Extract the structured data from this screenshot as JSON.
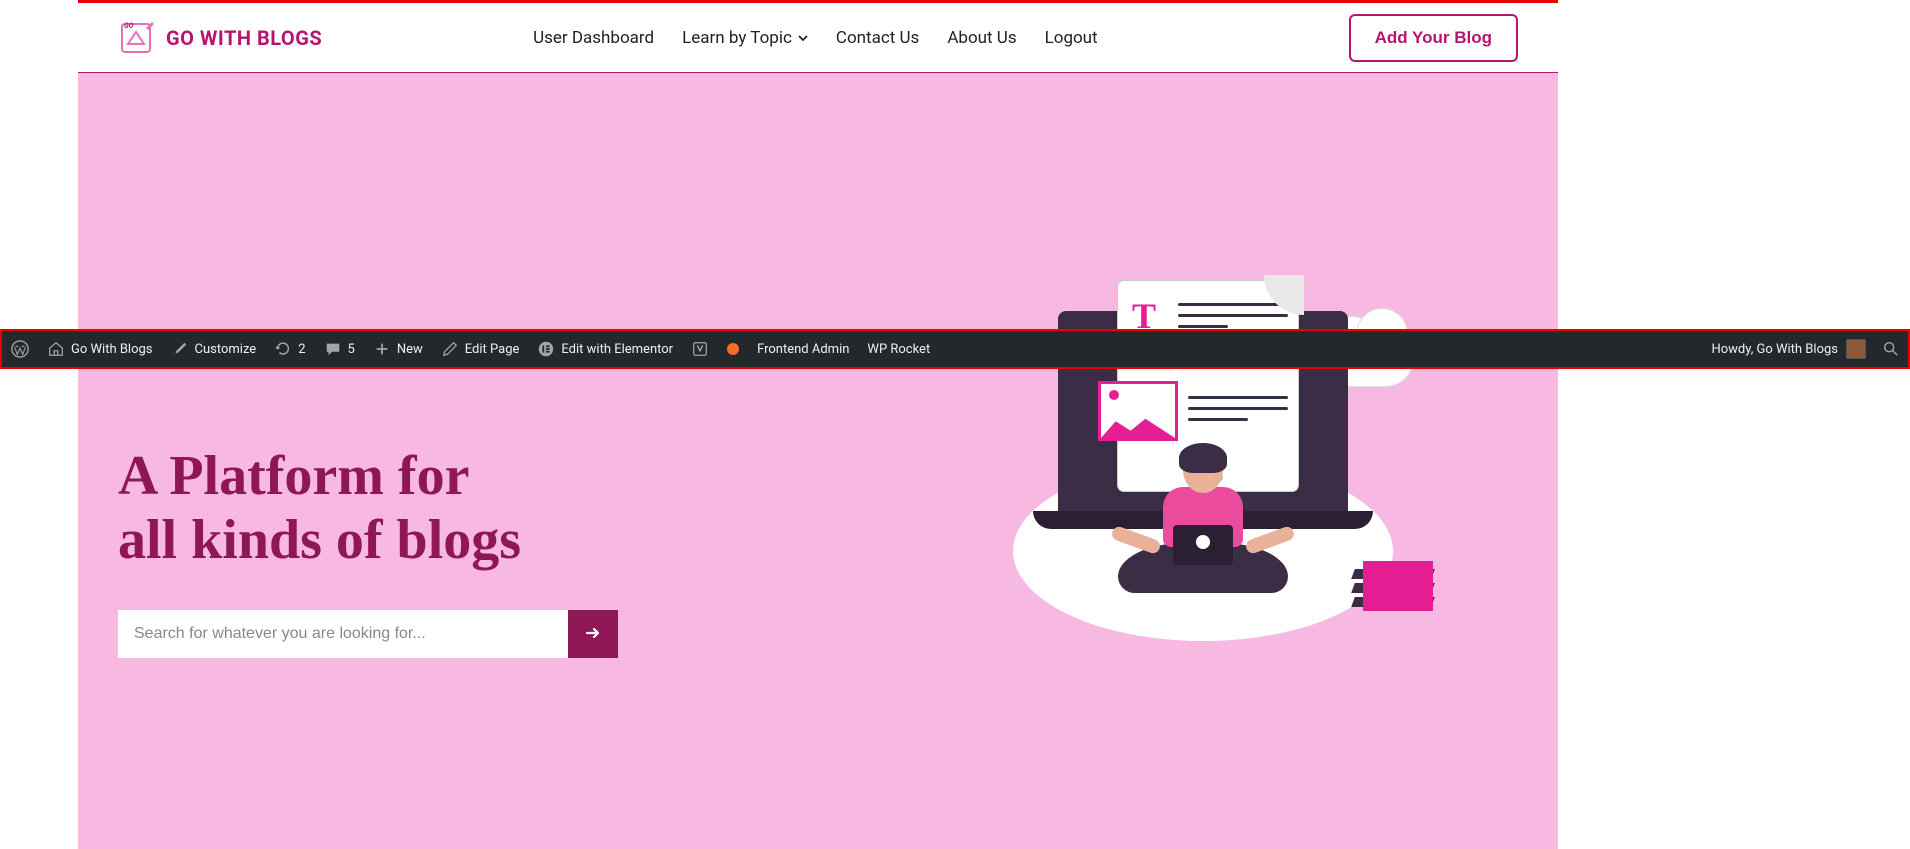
{
  "brand": {
    "name": "GO WITH BLOGS"
  },
  "nav": {
    "items": [
      {
        "label": "User Dashboard"
      },
      {
        "label": "Learn by Topic",
        "has_caret": true
      },
      {
        "label": "Contact Us"
      },
      {
        "label": "About Us"
      },
      {
        "label": "Logout"
      }
    ],
    "cta": "Add Your Blog"
  },
  "hero": {
    "title_line1": "A Platform for",
    "title_line2": "all kinds of blogs",
    "search_placeholder": "Search for whatever you are looking for..."
  },
  "wp_bar": {
    "site_name": "Go With Blogs",
    "customize": "Customize",
    "updates_count": "2",
    "comments_count": "5",
    "new": "New",
    "edit_page": "Edit Page",
    "edit_elementor": "Edit with Elementor",
    "frontend_admin": "Frontend Admin",
    "wp_rocket": "WP Rocket",
    "howdy": "Howdy, Go With Blogs"
  }
}
